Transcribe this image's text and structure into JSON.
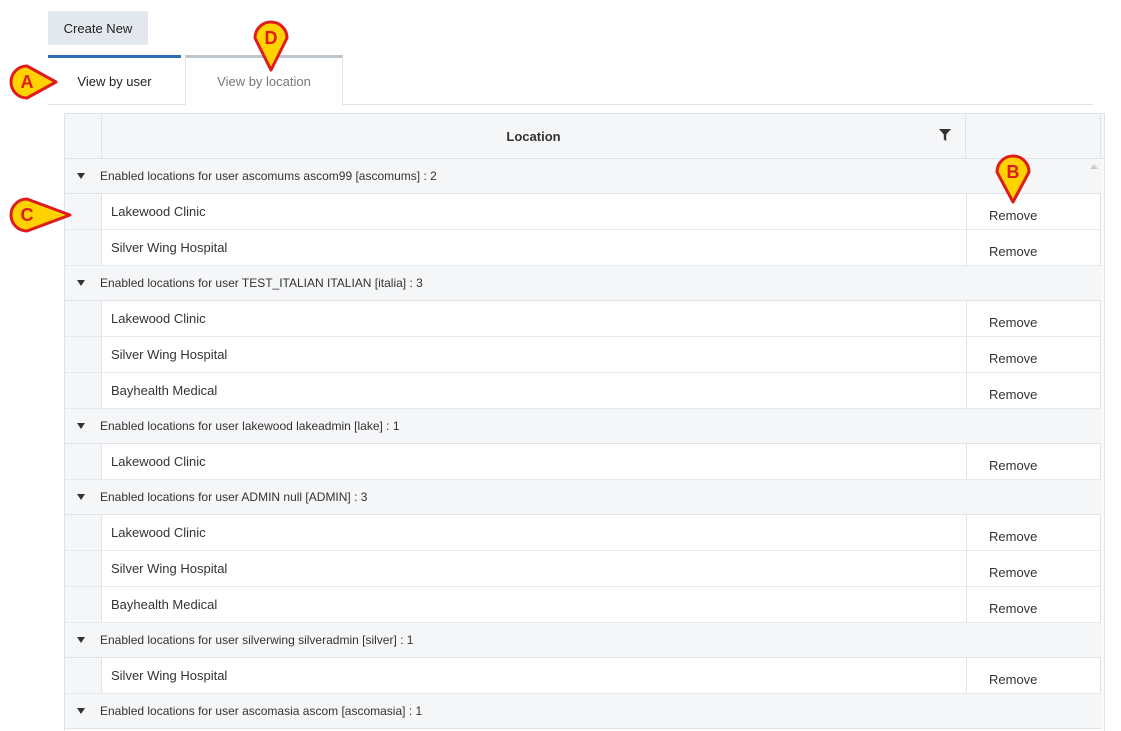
{
  "toolbar": {
    "create_new_label": "Create New"
  },
  "tabs": [
    {
      "label": "View by user",
      "active": true
    },
    {
      "label": "View by location",
      "active": false
    }
  ],
  "grid": {
    "column_location": "Location",
    "remove_label": "Remove",
    "groups": [
      {
        "label": "Enabled locations for user ascomums ascom99 [ascomums] : 2",
        "rows": [
          "Lakewood Clinic",
          "Silver Wing Hospital"
        ]
      },
      {
        "label": "Enabled locations for user TEST_ITALIAN ITALIAN [italia] : 3",
        "rows": [
          "Lakewood Clinic",
          "Silver Wing Hospital",
          "Bayhealth Medical"
        ]
      },
      {
        "label": "Enabled locations for user lakewood lakeadmin [lake] : 1",
        "rows": [
          "Lakewood Clinic"
        ]
      },
      {
        "label": "Enabled locations for user ADMIN null [ADMIN] : 3",
        "rows": [
          "Lakewood Clinic",
          "Silver Wing Hospital",
          "Bayhealth Medical"
        ]
      },
      {
        "label": "Enabled locations for user silverwing silveradmin [silver] : 1",
        "rows": [
          "Silver Wing Hospital"
        ]
      },
      {
        "label": "Enabled locations for user ascomasia ascom [ascomasia] : 1",
        "rows": []
      }
    ]
  },
  "callouts": [
    {
      "letter": "A"
    },
    {
      "letter": "B"
    },
    {
      "letter": "C"
    },
    {
      "letter": "D"
    }
  ],
  "colors": {
    "accent": "#2f6fb5",
    "callout_fill": "#ffd200",
    "callout_border": "#e01b1b"
  }
}
